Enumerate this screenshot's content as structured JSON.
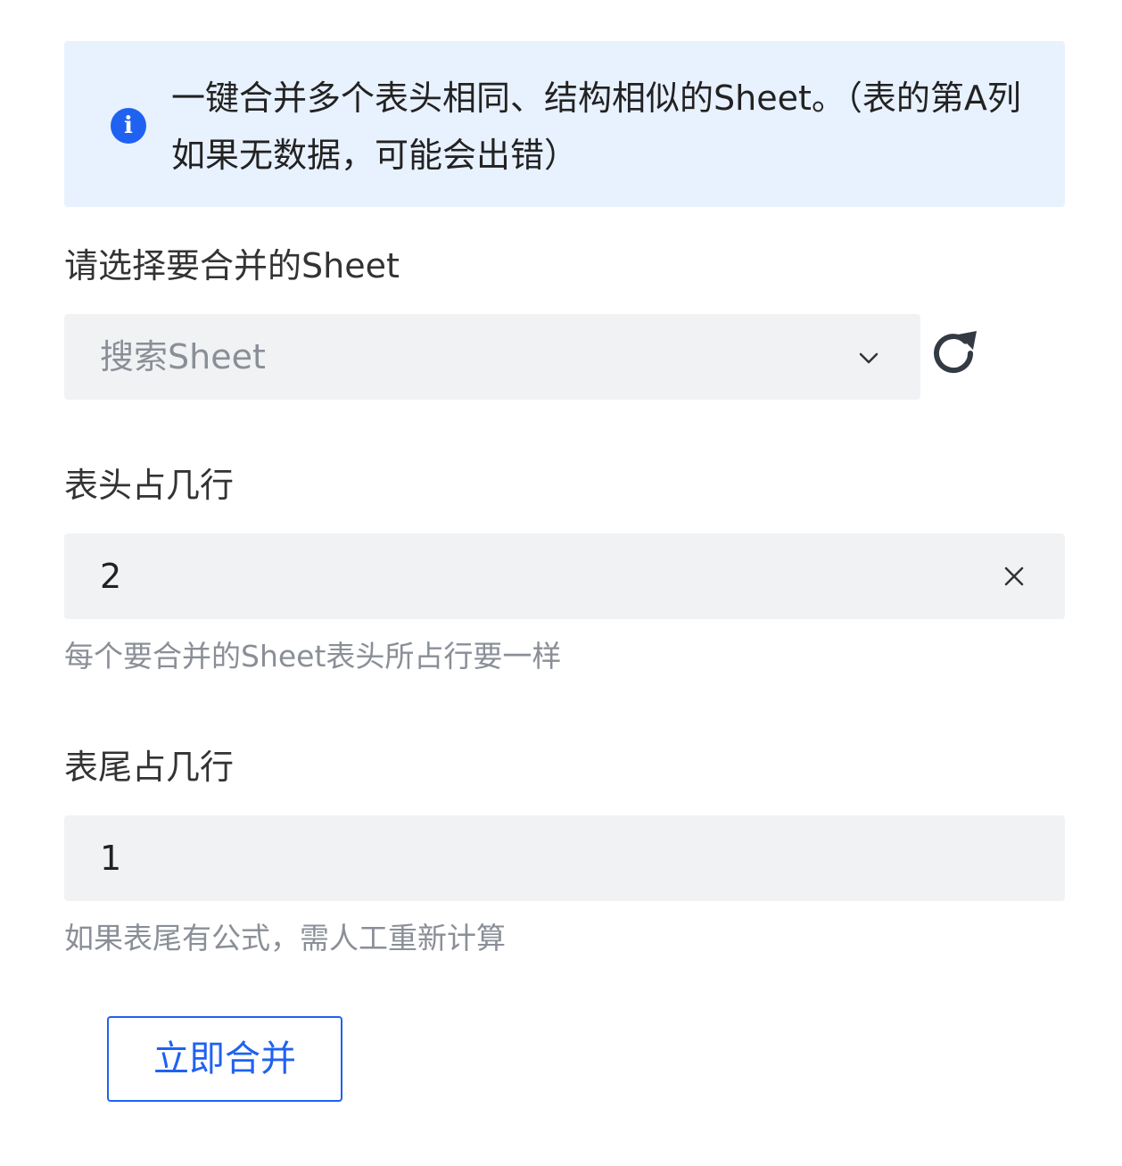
{
  "notice": {
    "icon": "info-icon",
    "text": "一键合并多个表头相同、结构相似的Sheet。（表的第A列如果无数据，可能会出错）"
  },
  "sheet_select": {
    "label": "请选择要合并的Sheet",
    "placeholder": "搜索Sheet",
    "dropdown_icon": "chevron-down-icon",
    "refresh_icon": "refresh-icon"
  },
  "header_rows": {
    "label": "表头占几行",
    "value": "2",
    "clear_icon": "close-icon",
    "help": "每个要合并的Sheet表头所占行要一样"
  },
  "footer_rows": {
    "label": "表尾占几行",
    "value": "1",
    "help": "如果表尾有公式，需人工重新计算"
  },
  "actions": {
    "merge_label": "立即合并"
  },
  "colors": {
    "accent": "#1f62f2",
    "notice_bg": "#e8f1fe",
    "field_bg": "#f1f2f4",
    "muted_text": "#8a8f97"
  }
}
